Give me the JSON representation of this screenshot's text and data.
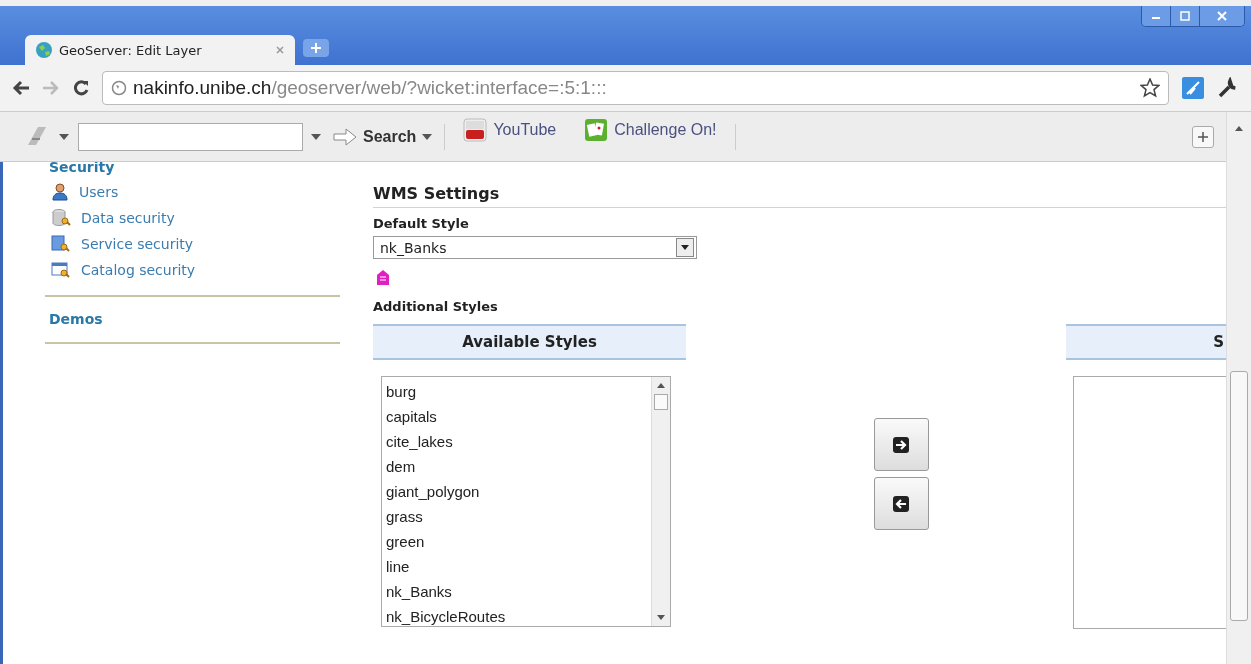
{
  "window": {
    "tab_title": "GeoServer: Edit Layer",
    "url_host": "nakinfo.unibe.ch",
    "url_path": "/geoserver/web/?wicket:interface=:5:1:::"
  },
  "toolbar": {
    "search_label": "Search",
    "bookmarks": [
      {
        "label": "YouTube",
        "kind": "video"
      },
      {
        "label": "Challenge On!",
        "kind": "cards"
      }
    ]
  },
  "sidebar": {
    "section_title": "Security",
    "items": [
      {
        "label": "Users",
        "kind": "users"
      },
      {
        "label": "Data security",
        "kind": "data"
      },
      {
        "label": "Service security",
        "kind": "service"
      },
      {
        "label": "Catalog security",
        "kind": "catalog"
      }
    ],
    "sections": [
      {
        "label": "Demos"
      }
    ]
  },
  "wms": {
    "title": "WMS Settings",
    "default_style_label": "Default Style",
    "default_style": "nk_Banks",
    "additional_label": "Additional Styles",
    "available": {
      "header": "Available Styles",
      "items": [
        "burg",
        "capitals",
        "cite_lakes",
        "dem",
        "giant_polygon",
        "grass",
        "green",
        "line",
        "nk_Banks",
        "nk_BicycleRoutes"
      ]
    },
    "selected": {
      "header": "S"
    }
  }
}
